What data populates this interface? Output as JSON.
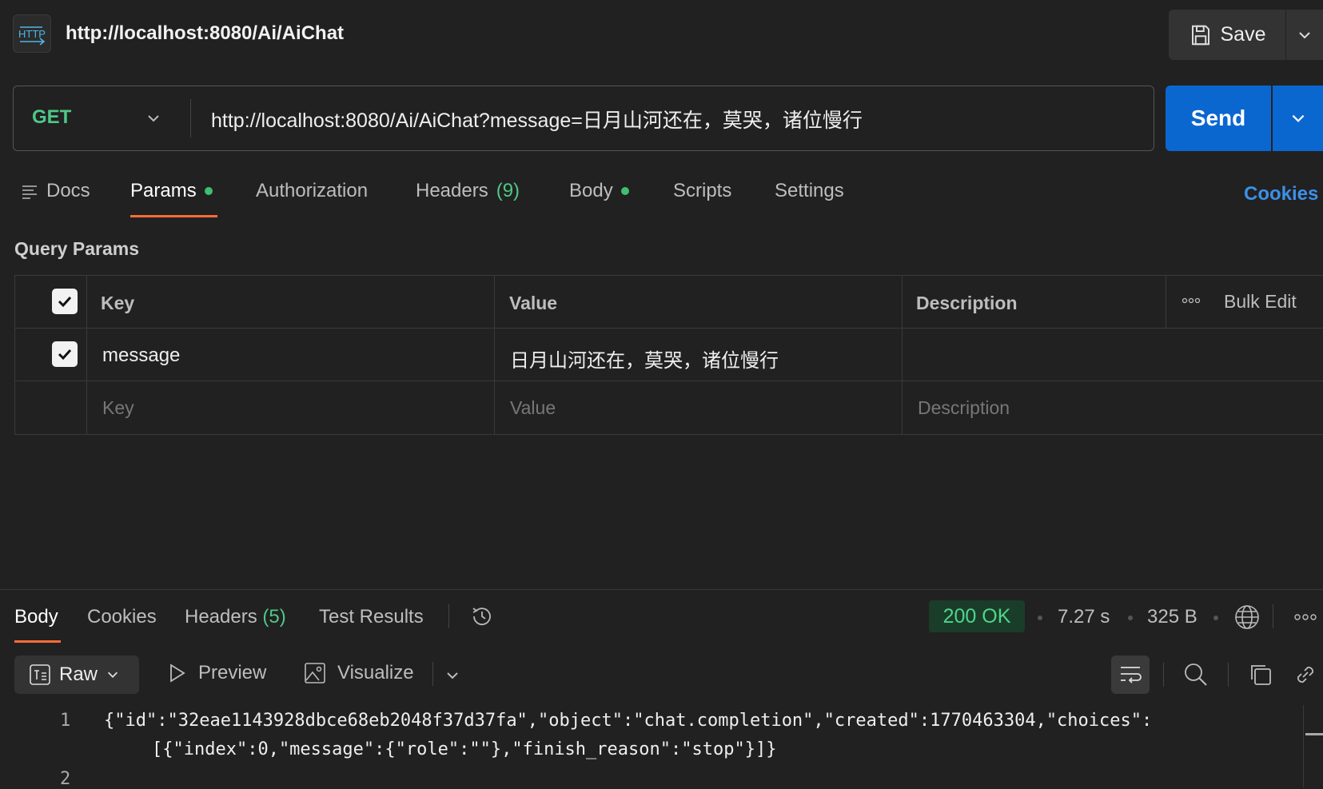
{
  "header": {
    "badge_text": "HTTP",
    "title": "http://localhost:8080/Ai/AiChat",
    "save_label": "Save"
  },
  "request": {
    "method": "GET",
    "url": "http://localhost:8080/Ai/AiChat?message=日月山河还在，莫哭，诸位慢行",
    "send_label": "Send"
  },
  "tabs": [
    {
      "label": "Docs"
    },
    {
      "label": "Params",
      "indicator": true
    },
    {
      "label": "Authorization"
    },
    {
      "label": "Headers",
      "count": "(9)"
    },
    {
      "label": "Body",
      "indicator": true
    },
    {
      "label": "Scripts"
    },
    {
      "label": "Settings"
    }
  ],
  "cookies_link": "Cookies",
  "query_params": {
    "title": "Query Params",
    "headers": {
      "key": "Key",
      "value": "Value",
      "description": "Description",
      "bulk_edit": "Bulk Edit"
    },
    "rows": [
      {
        "checked": true,
        "key": "message",
        "value": "日月山河还在，莫哭，诸位慢行",
        "description": ""
      }
    ],
    "placeholder": {
      "key": "Key",
      "value": "Value",
      "description": "Description"
    }
  },
  "response": {
    "tabs": [
      {
        "label": "Body"
      },
      {
        "label": "Cookies"
      },
      {
        "label": "Headers",
        "count": "(5)"
      },
      {
        "label": "Test Results"
      }
    ],
    "status": "200 OK",
    "time": "7.27 s",
    "size": "325 B",
    "view_modes": {
      "raw": "Raw",
      "preview": "Preview",
      "visualize": "Visualize"
    },
    "code": {
      "line_numbers": [
        "1",
        "2"
      ],
      "line1_a": "{\"id\":\"32eae1143928dbce68eb2048f37d37fa\",\"object\":\"chat.completion\",\"created\":1770463304,\"choices\":",
      "line1_b": "[{\"index\":0,\"message\":{\"role\":\"\"},\"finish_reason\":\"stop\"}]}"
    }
  },
  "colors": {
    "accent_send": "#0b67d0",
    "method_get": "#4fc787",
    "tab_active_underline": "#ff6c37",
    "status_ok": "#4fd68a",
    "link": "#3d8fe8"
  }
}
